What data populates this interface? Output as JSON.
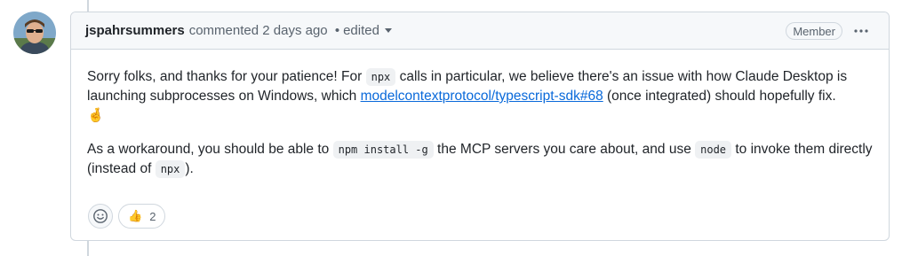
{
  "comment": {
    "author": "jspahrsummers",
    "action": "commented",
    "time": "2 days ago",
    "separator": "•",
    "edited": "edited",
    "badge": "Member"
  },
  "body": {
    "p1_part1": "Sorry folks, and thanks for your patience! For ",
    "p1_code1": "npx",
    "p1_part2": " calls in particular, we believe there's an issue with how Claude Desktop is launching subprocesses on Windows, which ",
    "p1_link": "modelcontextprotocol/typescript-sdk#68",
    "p1_part3": " (once integrated) should hopefully fix.",
    "p1_emoji": "🤞",
    "p2_part1": "As a workaround, you should be able to ",
    "p2_code1": "npm install -g",
    "p2_part2": " the MCP servers you care about, and use ",
    "p2_code2": "node",
    "p2_part3": " to invoke them directly (instead of ",
    "p2_code3": "npx",
    "p2_part4": ")."
  },
  "reactions": {
    "thumbs_up_emoji": "👍",
    "thumbs_up_count": "2"
  },
  "icons": {
    "smiley": "smiley-icon",
    "kebab": "kebab-horizontal-icon",
    "caret": "triangle-down-icon"
  },
  "colors": {
    "link": "#0969da",
    "border": "#d0d7de",
    "header_bg": "#f6f8fa"
  }
}
